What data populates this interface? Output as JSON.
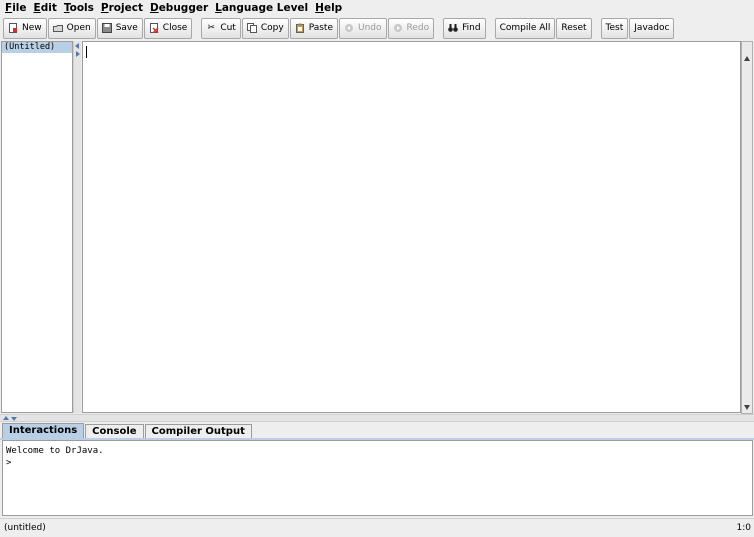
{
  "menubar": {
    "items": [
      {
        "mnemonic": "F",
        "rest": "ile"
      },
      {
        "mnemonic": "E",
        "rest": "dit"
      },
      {
        "mnemonic": "T",
        "rest": "ools"
      },
      {
        "mnemonic": "P",
        "rest": "roject"
      },
      {
        "mnemonic": "D",
        "rest": "ebugger"
      },
      {
        "mnemonic": "L",
        "rest": "anguage Level"
      },
      {
        "mnemonic": "H",
        "rest": "elp"
      }
    ]
  },
  "toolbar": {
    "new": "New",
    "open": "Open",
    "save": "Save",
    "close": "Close",
    "cut": "Cut",
    "copy": "Copy",
    "paste": "Paste",
    "undo": "Undo",
    "redo": "Redo",
    "find": "Find",
    "compile_all": "Compile All",
    "reset": "Reset",
    "test": "Test",
    "javadoc": "Javadoc"
  },
  "filelist": {
    "items": [
      "(Untitled)"
    ]
  },
  "tabs": {
    "interactions": "Interactions",
    "console": "Console",
    "compiler_output": "Compiler Output"
  },
  "interactions": {
    "welcome": "Welcome to DrJava.",
    "prompt": ">"
  },
  "statusbar": {
    "file": "(untitled)",
    "position": "1:0"
  },
  "colors": {
    "selection": "#b8cfe5",
    "arrow": "#5577aa"
  }
}
